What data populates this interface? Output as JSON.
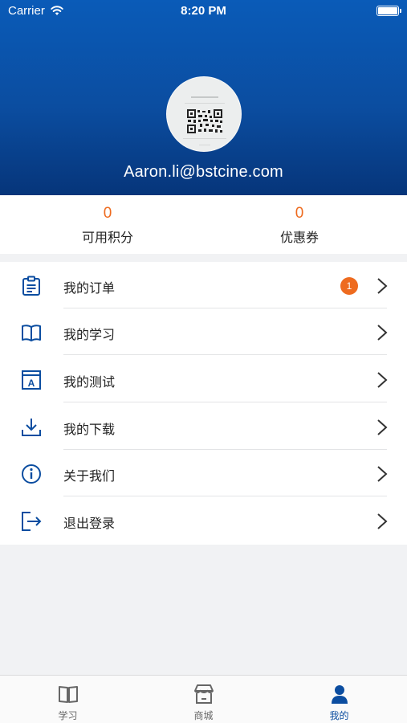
{
  "status_bar": {
    "carrier": "Carrier",
    "time": "8:20 PM"
  },
  "profile": {
    "email": "Aaron.li@bstcine.com"
  },
  "stats": [
    {
      "value": "0",
      "label": "可用积分"
    },
    {
      "value": "0",
      "label": "优惠券"
    }
  ],
  "menu": {
    "items": [
      {
        "label": "我的订单",
        "icon": "clipboard-icon",
        "badge": "1"
      },
      {
        "label": "我的学习",
        "icon": "book-icon"
      },
      {
        "label": "我的测试",
        "icon": "test-icon"
      },
      {
        "label": "我的下载",
        "icon": "download-icon"
      },
      {
        "label": "关于我们",
        "icon": "info-icon"
      },
      {
        "label": "退出登录",
        "icon": "logout-icon"
      }
    ]
  },
  "tabbar": {
    "tabs": [
      {
        "label": "学习",
        "icon": "book-icon"
      },
      {
        "label": "商城",
        "icon": "store-icon"
      },
      {
        "label": "我的",
        "icon": "person-icon",
        "active": true
      }
    ]
  },
  "colors": {
    "accent": "#0b4da0",
    "badge": "#ee6b1f",
    "stat_value": "#ee6b1f"
  }
}
